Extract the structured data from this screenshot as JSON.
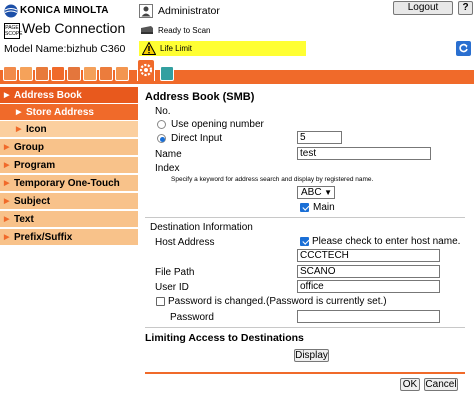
{
  "brand": {
    "company": "KONICA MINOLTA",
    "pagescope_top": "PAGE",
    "pagescope_bottom": "SCOPE",
    "app_name": "Web Connection",
    "model_name": "Model Name:bizhub C360"
  },
  "header": {
    "user": "Administrator",
    "logout_label": "Logout",
    "help_label": "?",
    "status": "Ready to Scan",
    "warning": "Life Limit"
  },
  "colors": {
    "accent": "#f06a2a",
    "warning_bg": "#ffff33"
  },
  "tabs": [
    "maintenance-icon",
    "system-settings-icon",
    "security-icon",
    "user-auth-icon",
    "network-icon",
    "box-icon",
    "print-settings-icon",
    "store-address-icon",
    "fax-settings-icon"
  ],
  "sidebar": {
    "items": [
      {
        "label": "Address Book",
        "type": "top"
      },
      {
        "label": "Store Address",
        "type": "sub-active"
      },
      {
        "label": "Icon",
        "type": "sub"
      },
      {
        "label": "Group",
        "type": "main"
      },
      {
        "label": "Program",
        "type": "main"
      },
      {
        "label": "Temporary One-Touch",
        "type": "main"
      },
      {
        "label": "Subject",
        "type": "main"
      },
      {
        "label": "Text",
        "type": "main"
      },
      {
        "label": "Prefix/Suffix",
        "type": "main"
      }
    ]
  },
  "form": {
    "title": "Address Book (SMB)",
    "no_label": "No.",
    "use_opening_label": "Use opening number",
    "direct_input_label": "Direct Input",
    "no_value": "5",
    "name_label": "Name",
    "name_value": "test",
    "index_label": "Index",
    "index_help": "Specify a keyword for address search and display by registered name.",
    "index_value": "ABC",
    "main_label": "Main",
    "dest_info_label": "Destination Information",
    "host_address_label": "Host Address",
    "host_check_label": "Please check to enter host name.",
    "host_value": "CCCTECH",
    "file_path_label": "File Path",
    "file_path_value": "SCANO",
    "user_id_label": "User ID",
    "user_id_value": "office",
    "password_changed_label": "Password is changed.",
    "password_set_label": "(Password is currently set.)",
    "password_label": "Password",
    "password_value": "",
    "limiting_label": "Limiting Access to Destinations",
    "display_label": "Display",
    "ok_label": "OK",
    "cancel_label": "Cancel"
  }
}
